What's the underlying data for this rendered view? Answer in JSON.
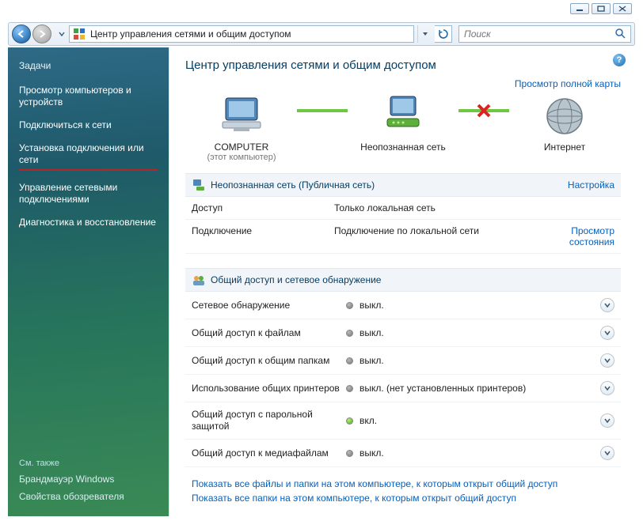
{
  "window_controls": {
    "min": "_",
    "max": "□",
    "close": "×"
  },
  "nav": {
    "address": "Центр управления сетями и общим доступом",
    "search_placeholder": "Поиск"
  },
  "sidebar": {
    "tasks_header": "Задачи",
    "items": [
      "Просмотр компьютеров и устройств",
      "Подключиться к сети",
      "Установка подключения или сети",
      "Управление сетевыми подключениями",
      "Диагностика и восстановление"
    ],
    "see_also_header": "См. также",
    "see_also": [
      "Брандмауэр Windows",
      "Свойства обозревателя"
    ]
  },
  "page": {
    "title": "Центр управления сетями и общим доступом",
    "full_map_link": "Просмотр полной карты",
    "diagram": {
      "node1_label": "COMPUTER",
      "node1_sub": "(этот компьютер)",
      "node2_label": "Неопознанная сеть",
      "node3_label": "Интернет"
    },
    "network_section": {
      "header": "Неопознанная сеть (Публичная сеть)",
      "config_link": "Настройка",
      "rows": [
        {
          "k": "Доступ",
          "v": "Только локальная сеть",
          "rlink": ""
        },
        {
          "k": "Подключение",
          "v": "Подключение по локальной сети",
          "rlink": "Просмотр состояния"
        }
      ]
    },
    "sharing_section": {
      "header": "Общий доступ и сетевое обнаружение",
      "rows": [
        {
          "label": "Сетевое обнаружение",
          "state": "off",
          "value": "выкл."
        },
        {
          "label": "Общий доступ к файлам",
          "state": "off",
          "value": "выкл."
        },
        {
          "label": "Общий доступ к общим папкам",
          "state": "off",
          "value": "выкл."
        },
        {
          "label": "Использование общих принтеров",
          "state": "off",
          "value": "выкл. (нет установленных принтеров)"
        },
        {
          "label": "Общий доступ с парольной защитой",
          "state": "on",
          "value": "вкл."
        },
        {
          "label": "Общий доступ к медиафайлам",
          "state": "off",
          "value": "выкл."
        }
      ]
    },
    "bottom_links": [
      "Показать все файлы и папки на этом компьютере, к которым открыт общий доступ",
      "Показать все папки на этом компьютере, к которым открыт общий доступ"
    ]
  }
}
